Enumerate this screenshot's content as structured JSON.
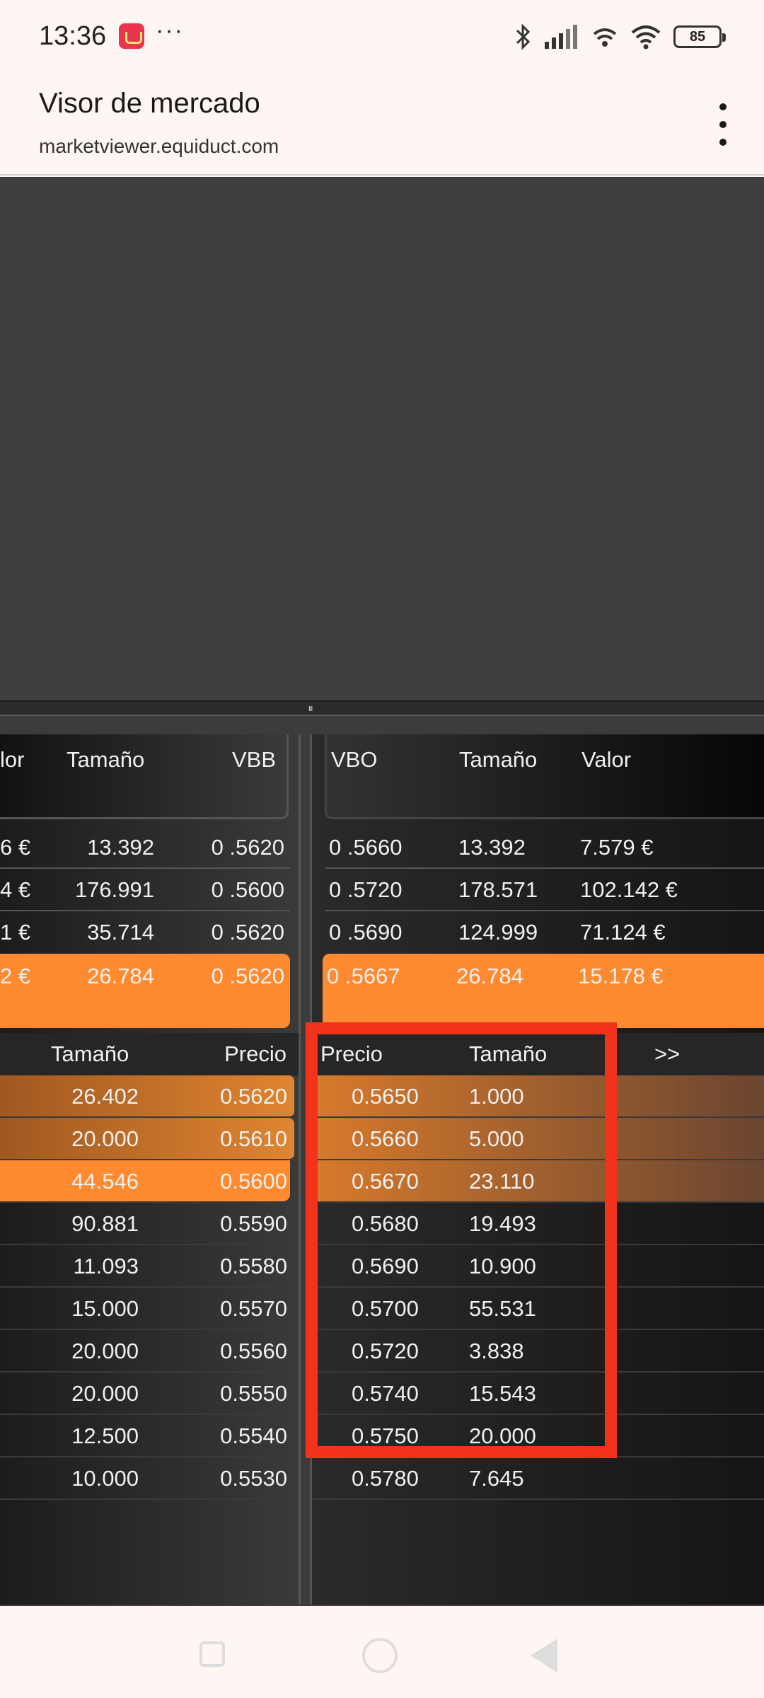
{
  "status": {
    "time": "13:36",
    "dots": "···",
    "battery": "85"
  },
  "header": {
    "title": "Visor de mercado",
    "url": "marketviewer.equiduct.com"
  },
  "splitter_grip": "III",
  "bid_quote": {
    "headers": [
      "lor",
      "Tamaño",
      "VBB"
    ],
    "rows": [
      {
        "valor": "6 €",
        "tamano": "13.392",
        "vbb": "0 .5620"
      },
      {
        "valor": "4 €",
        "tamano": "176.991",
        "vbb": "0 .5600"
      },
      {
        "valor": "1 €",
        "tamano": "35.714",
        "vbb": "0 .5620"
      },
      {
        "valor": "2 €",
        "tamano": "26.784",
        "vbb": "0 .5620"
      }
    ]
  },
  "ask_quote": {
    "headers": [
      "VBO",
      "Tamaño",
      "Valor"
    ],
    "rows": [
      {
        "vbo": "0 .5660",
        "tamano": "13.392",
        "valor": "7.579 €"
      },
      {
        "vbo": "0 .5720",
        "tamano": "178.571",
        "valor": "102.142 €"
      },
      {
        "vbo": "0 .5690",
        "tamano": "124.999",
        "valor": "71.124 €"
      },
      {
        "vbo": "0 .5667",
        "tamano": "26.784",
        "valor": "15.178 €"
      }
    ]
  },
  "bid_depth": {
    "headers": [
      "Tamaño",
      "Precio"
    ],
    "rows": [
      {
        "tamano": "26.402",
        "precio": "0.5620"
      },
      {
        "tamano": "20.000",
        "precio": "0.5610"
      },
      {
        "tamano": "44.546",
        "precio": "0.5600"
      },
      {
        "tamano": "90.881",
        "precio": "0.5590"
      },
      {
        "tamano": "11.093",
        "precio": "0.5580"
      },
      {
        "tamano": "15.000",
        "precio": "0.5570"
      },
      {
        "tamano": "20.000",
        "precio": "0.5560"
      },
      {
        "tamano": "20.000",
        "precio": "0.5550"
      },
      {
        "tamano": "12.500",
        "precio": "0.5540"
      },
      {
        "tamano": "10.000",
        "precio": "0.5530"
      }
    ]
  },
  "ask_depth": {
    "headers": [
      "Precio",
      "Tamaño",
      ">>"
    ],
    "rows": [
      {
        "precio": "0.5650",
        "tamano": "1.000"
      },
      {
        "precio": "0.5660",
        "tamano": "5.000"
      },
      {
        "precio": "0.5670",
        "tamano": "23.110"
      },
      {
        "precio": "0.5680",
        "tamano": "19.493"
      },
      {
        "precio": "0.5690",
        "tamano": "10.900"
      },
      {
        "precio": "0.5700",
        "tamano": "55.531"
      },
      {
        "precio": "0.5720",
        "tamano": "3.838"
      },
      {
        "precio": "0.5740",
        "tamano": "15.543"
      },
      {
        "precio": "0.5750",
        "tamano": "20.000"
      },
      {
        "precio": "0.5780",
        "tamano": "7.645"
      }
    ]
  },
  "colors": {
    "highlight": "#ff8a30",
    "annotation": "#f2321a",
    "background": "#3c3c3c"
  }
}
